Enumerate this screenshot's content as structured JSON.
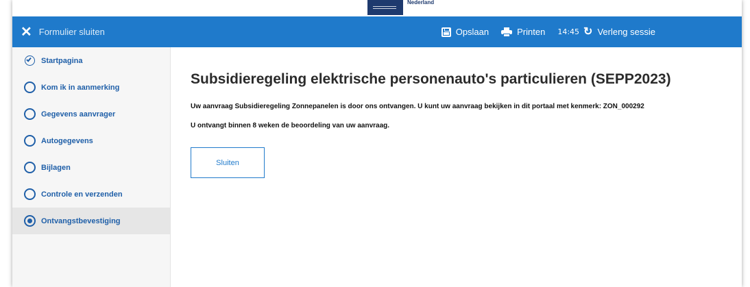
{
  "logo": {
    "text": "Nederland"
  },
  "topbar": {
    "close_label": "Formulier sluiten",
    "save_label": "Opslaan",
    "print_label": "Printen",
    "time": "14:45",
    "renew_label": "Verleng sessie",
    "color": "#1f7acb"
  },
  "sidebar": {
    "items": [
      {
        "label": "Startpagina",
        "state": "done",
        "icon": "check-circle-icon"
      },
      {
        "label": "Kom ik in aanmerking",
        "state": "todo",
        "icon": "circle-icon"
      },
      {
        "label": "Gegevens aanvrager",
        "state": "todo",
        "icon": "circle-icon"
      },
      {
        "label": "Autogegevens",
        "state": "todo",
        "icon": "circle-icon"
      },
      {
        "label": "Bijlagen",
        "state": "todo",
        "icon": "circle-icon"
      },
      {
        "label": "Controle en verzenden",
        "state": "todo",
        "icon": "circle-icon"
      },
      {
        "label": "Ontvangstbevestiging",
        "state": "current",
        "icon": "radio-selected-icon"
      }
    ]
  },
  "main": {
    "title": "Subsidieregeling elektrische personenauto's particulieren (SEPP2023)",
    "message_1": "Uw aanvraag Subsidieregeling Zonnepanelen is door ons ontvangen. U kunt uw aanvraag bekijken in dit portaal met kenmerk: ZON_000292",
    "message_2": "U ontvangt binnen 8 weken de beoordeling van uw aanvraag.",
    "close_button_label": "Sluiten"
  }
}
